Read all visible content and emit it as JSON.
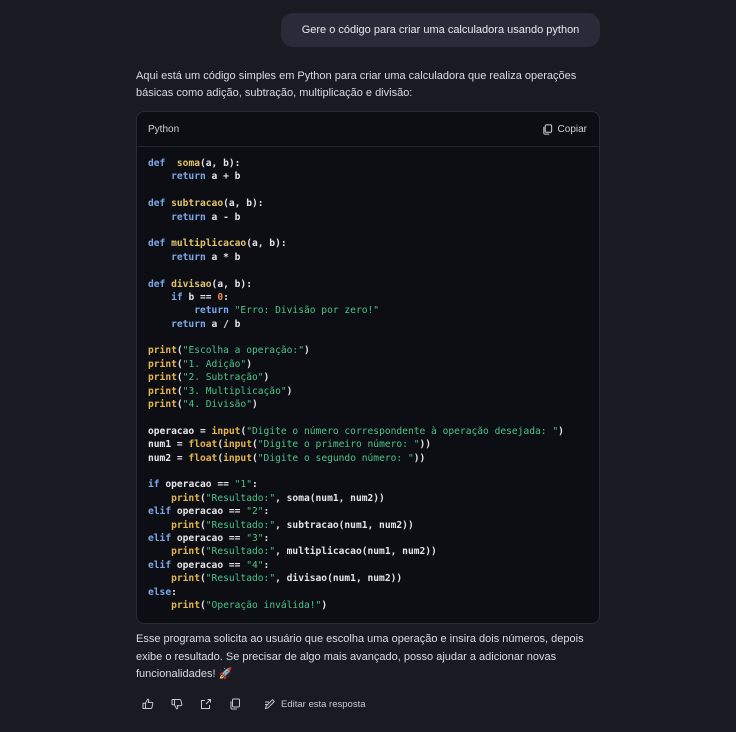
{
  "conversation": {
    "user_message": "Gere o código para criar uma calculadora usando python",
    "assistant": {
      "intro": "Aqui está um código simples em Python para criar uma calculadora que realiza operações básicas como adição, subtração, multiplicação e divisão:",
      "code_block": {
        "language": "Python",
        "copy_label": "Copiar",
        "lines": [
          [
            [
              "kw",
              "def"
            ],
            [
              "",
              "  "
            ],
            [
              "fn",
              "soma"
            ],
            [
              "",
              "(a, b):"
            ]
          ],
          [
            [
              "",
              "    "
            ],
            [
              "kw",
              "return"
            ],
            [
              "",
              " a + b"
            ]
          ],
          [],
          [
            [
              "kw",
              "def"
            ],
            [
              "",
              " "
            ],
            [
              "fn",
              "subtracao"
            ],
            [
              "",
              "(a, b):"
            ]
          ],
          [
            [
              "",
              "    "
            ],
            [
              "kw",
              "return"
            ],
            [
              "",
              " a - b"
            ]
          ],
          [],
          [
            [
              "kw",
              "def"
            ],
            [
              "",
              " "
            ],
            [
              "fn",
              "multiplicacao"
            ],
            [
              "",
              "(a, b):"
            ]
          ],
          [
            [
              "",
              "    "
            ],
            [
              "kw",
              "return"
            ],
            [
              "",
              " a * b"
            ]
          ],
          [],
          [
            [
              "kw",
              "def"
            ],
            [
              "",
              " "
            ],
            [
              "fn",
              "divisao"
            ],
            [
              "",
              "(a, b):"
            ]
          ],
          [
            [
              "",
              "    "
            ],
            [
              "kw",
              "if"
            ],
            [
              "",
              " b == "
            ],
            [
              "num",
              "0"
            ],
            [
              "",
              ":"
            ]
          ],
          [
            [
              "",
              "        "
            ],
            [
              "kw",
              "return"
            ],
            [
              "",
              " "
            ],
            [
              "str",
              "\"Erro: Divisão por zero!\""
            ]
          ],
          [
            [
              "",
              "    "
            ],
            [
              "kw",
              "return"
            ],
            [
              "",
              " a / b"
            ]
          ],
          [],
          [
            [
              "bi",
              "print"
            ],
            [
              "",
              "("
            ],
            [
              "str",
              "\"Escolha a operação:\""
            ],
            [
              "",
              ")"
            ]
          ],
          [
            [
              "bi",
              "print"
            ],
            [
              "",
              "("
            ],
            [
              "str",
              "\"1. Adição\""
            ],
            [
              "",
              ")"
            ]
          ],
          [
            [
              "bi",
              "print"
            ],
            [
              "",
              "("
            ],
            [
              "str",
              "\"2. Subtração\""
            ],
            [
              "",
              ")"
            ]
          ],
          [
            [
              "bi",
              "print"
            ],
            [
              "",
              "("
            ],
            [
              "str",
              "\"3. Multiplicação\""
            ],
            [
              "",
              ")"
            ]
          ],
          [
            [
              "bi",
              "print"
            ],
            [
              "",
              "("
            ],
            [
              "str",
              "\"4. Divisão\""
            ],
            [
              "",
              ")"
            ]
          ],
          [],
          [
            [
              "",
              "operacao = "
            ],
            [
              "bi",
              "input"
            ],
            [
              "",
              "("
            ],
            [
              "str",
              "\"Digite o número correspondente à operação desejada: \""
            ],
            [
              "",
              ")"
            ]
          ],
          [
            [
              "",
              "num1 = "
            ],
            [
              "bi",
              "float"
            ],
            [
              "",
              "("
            ],
            [
              "bi",
              "input"
            ],
            [
              "",
              "("
            ],
            [
              "str",
              "\"Digite o primeiro número: \""
            ],
            [
              "",
              "))"
            ]
          ],
          [
            [
              "",
              "num2 = "
            ],
            [
              "bi",
              "float"
            ],
            [
              "",
              "("
            ],
            [
              "bi",
              "input"
            ],
            [
              "",
              "("
            ],
            [
              "str",
              "\"Digite o segundo número: \""
            ],
            [
              "",
              "))"
            ]
          ],
          [],
          [
            [
              "kw",
              "if"
            ],
            [
              "",
              " operacao == "
            ],
            [
              "str",
              "\"1\""
            ],
            [
              "",
              ":"
            ]
          ],
          [
            [
              "",
              "    "
            ],
            [
              "bi",
              "print"
            ],
            [
              "",
              "("
            ],
            [
              "str",
              "\"Resultado:\""
            ],
            [
              "",
              ", soma(num1, num2))"
            ]
          ],
          [
            [
              "kw",
              "elif"
            ],
            [
              "",
              " operacao == "
            ],
            [
              "str",
              "\"2\""
            ],
            [
              "",
              ":"
            ]
          ],
          [
            [
              "",
              "    "
            ],
            [
              "bi",
              "print"
            ],
            [
              "",
              "("
            ],
            [
              "str",
              "\"Resultado:\""
            ],
            [
              "",
              ", subtracao(num1, num2))"
            ]
          ],
          [
            [
              "kw",
              "elif"
            ],
            [
              "",
              " operacao == "
            ],
            [
              "str",
              "\"3\""
            ],
            [
              "",
              ":"
            ]
          ],
          [
            [
              "",
              "    "
            ],
            [
              "bi",
              "print"
            ],
            [
              "",
              "("
            ],
            [
              "str",
              "\"Resultado:\""
            ],
            [
              "",
              ", multiplicacao(num1, num2))"
            ]
          ],
          [
            [
              "kw",
              "elif"
            ],
            [
              "",
              " operacao == "
            ],
            [
              "str",
              "\"4\""
            ],
            [
              "",
              ":"
            ]
          ],
          [
            [
              "",
              "    "
            ],
            [
              "bi",
              "print"
            ],
            [
              "",
              "("
            ],
            [
              "str",
              "\"Resultado:\""
            ],
            [
              "",
              ", divisao(num1, num2))"
            ]
          ],
          [
            [
              "kw",
              "else"
            ],
            [
              "",
              ":"
            ]
          ],
          [
            [
              "",
              "    "
            ],
            [
              "bi",
              "print"
            ],
            [
              "",
              "("
            ],
            [
              "str",
              "\"Operação inválida!\""
            ],
            [
              "",
              ")"
            ]
          ]
        ]
      },
      "outro": "Esse programa solicita ao usuário que escolha uma operação e insira dois números, depois exibe o resultado. Se precisar de algo mais avançado, posso ajudar a adicionar novas funcionalidades! 🚀"
    },
    "actions": {
      "icons": [
        "thumbs-up-icon",
        "thumbs-down-icon",
        "share-icon",
        "copy-icon"
      ],
      "edit_label": "Editar esta resposta"
    }
  }
}
